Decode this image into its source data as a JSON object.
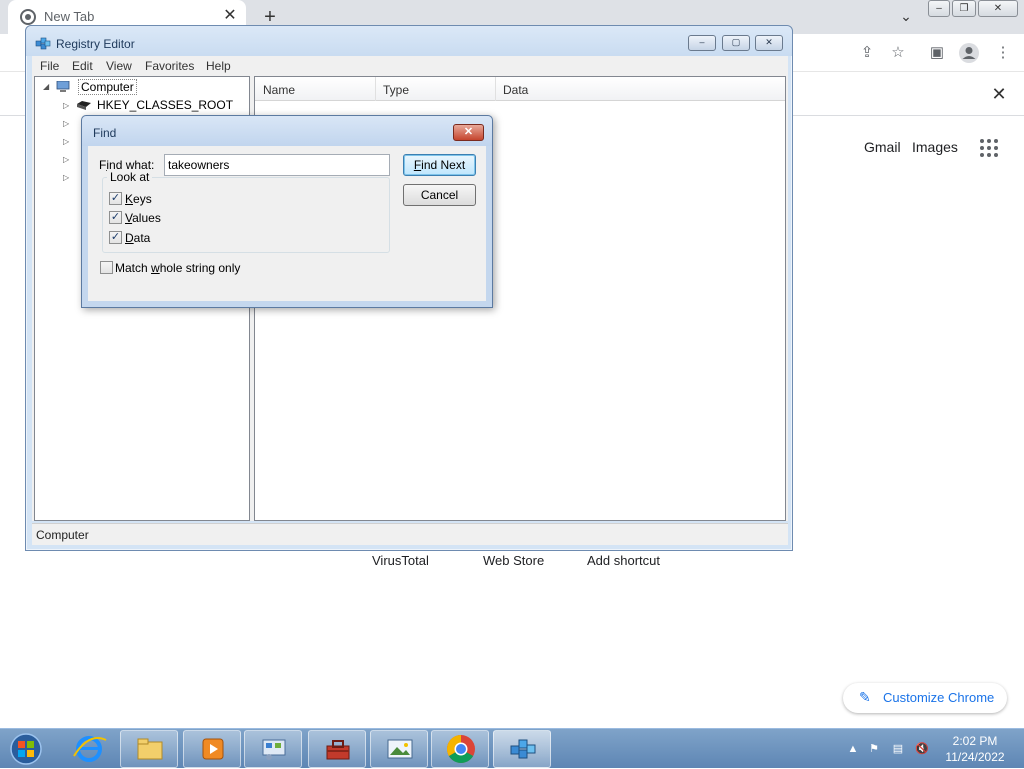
{
  "chrome": {
    "tab_title": "New Tab",
    "tab_close": "✕",
    "new_tab": "+",
    "infobar_close": "✕",
    "ntp_links": [
      "Gmail",
      "Images"
    ],
    "shortcuts": [
      "VirusTotal",
      "Web Store",
      "Add shortcut"
    ],
    "customize_label": "Customize Chrome",
    "window_controls": [
      "–",
      "❐",
      "✕"
    ]
  },
  "regedit": {
    "title": "Registry Editor",
    "menu": [
      "File",
      "Edit",
      "View",
      "Favorites",
      "Help"
    ],
    "title_buttons": [
      "–",
      "▢",
      "✕"
    ],
    "tree": {
      "root": "Computer",
      "items": [
        "HKEY_CLASSES_ROOT"
      ]
    },
    "columns": [
      "Name",
      "Type",
      "Data"
    ],
    "status": "Computer"
  },
  "find_dialog": {
    "title": "Find",
    "find_what_label_prefix": "F",
    "find_what_label_underlined": "i",
    "find_what_label_suffix": "nd what:",
    "search_value": "takeowners",
    "find_next_prefix": "",
    "find_next_underlined": "F",
    "find_next_suffix": "ind Next",
    "cancel_label": "Cancel",
    "look_at_label": "Look at",
    "options": [
      {
        "prefix": "",
        "underlined": "K",
        "suffix": "eys",
        "checked": true
      },
      {
        "prefix": "",
        "underlined": "V",
        "suffix": "alues",
        "checked": true
      },
      {
        "prefix": "",
        "underlined": "D",
        "suffix": "ata",
        "checked": true
      }
    ],
    "match_whole": {
      "prefix": "Match ",
      "underlined": "w",
      "suffix": "hole string only",
      "checked": false
    }
  },
  "taskbar": {
    "clock_time": "2:02 PM",
    "clock_date": "11/24/2022"
  },
  "colors": {
    "accent": "#1a73e8",
    "taskbar": "#6b8fbd"
  }
}
